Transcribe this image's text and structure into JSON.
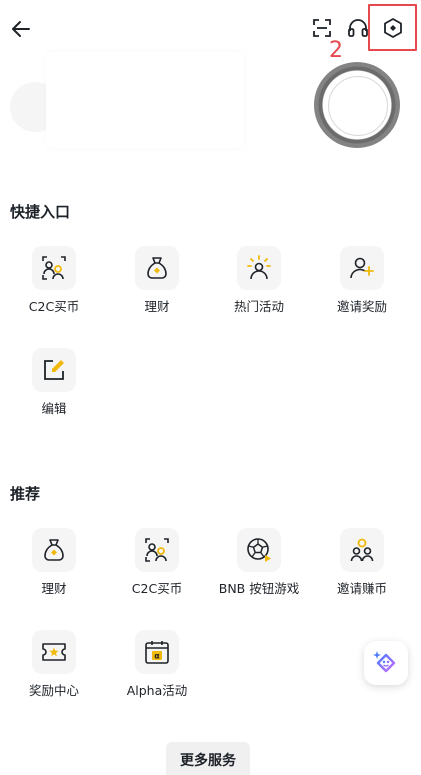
{
  "annotation": {
    "step": "2",
    "color": "#e5484d"
  },
  "colors": {
    "accent": "#f0b90b",
    "text": "#1e2329",
    "tile": "#f5f5f5"
  },
  "topbar": {
    "back_icon": "arrow-left-icon",
    "scan_icon": "scan-icon",
    "support_icon": "headset-icon",
    "settings_icon": "settings-hexagon-icon"
  },
  "quick_access": {
    "title": "快捷入口",
    "items": [
      {
        "label": "C2C买币",
        "icon": "c2c-users-icon"
      },
      {
        "label": "理财",
        "icon": "money-bag-icon"
      },
      {
        "label": "热门活动",
        "icon": "hot-activity-icon"
      },
      {
        "label": "邀请奖励",
        "icon": "invite-user-icon"
      },
      {
        "label": "编辑",
        "icon": "edit-icon"
      }
    ]
  },
  "recommended": {
    "title": "推荐",
    "items": [
      {
        "label": "理财",
        "icon": "money-bag-icon"
      },
      {
        "label": "C2C买币",
        "icon": "c2c-users-icon"
      },
      {
        "label": "BNB 按钮游戏",
        "icon": "game-ball-icon"
      },
      {
        "label": "邀请赚币",
        "icon": "invite-earn-icon"
      },
      {
        "label": "奖励中心",
        "icon": "reward-ticket-icon"
      },
      {
        "label": "Alpha活动",
        "icon": "alpha-calendar-icon"
      }
    ]
  },
  "more_button": {
    "label": "更多服务"
  }
}
